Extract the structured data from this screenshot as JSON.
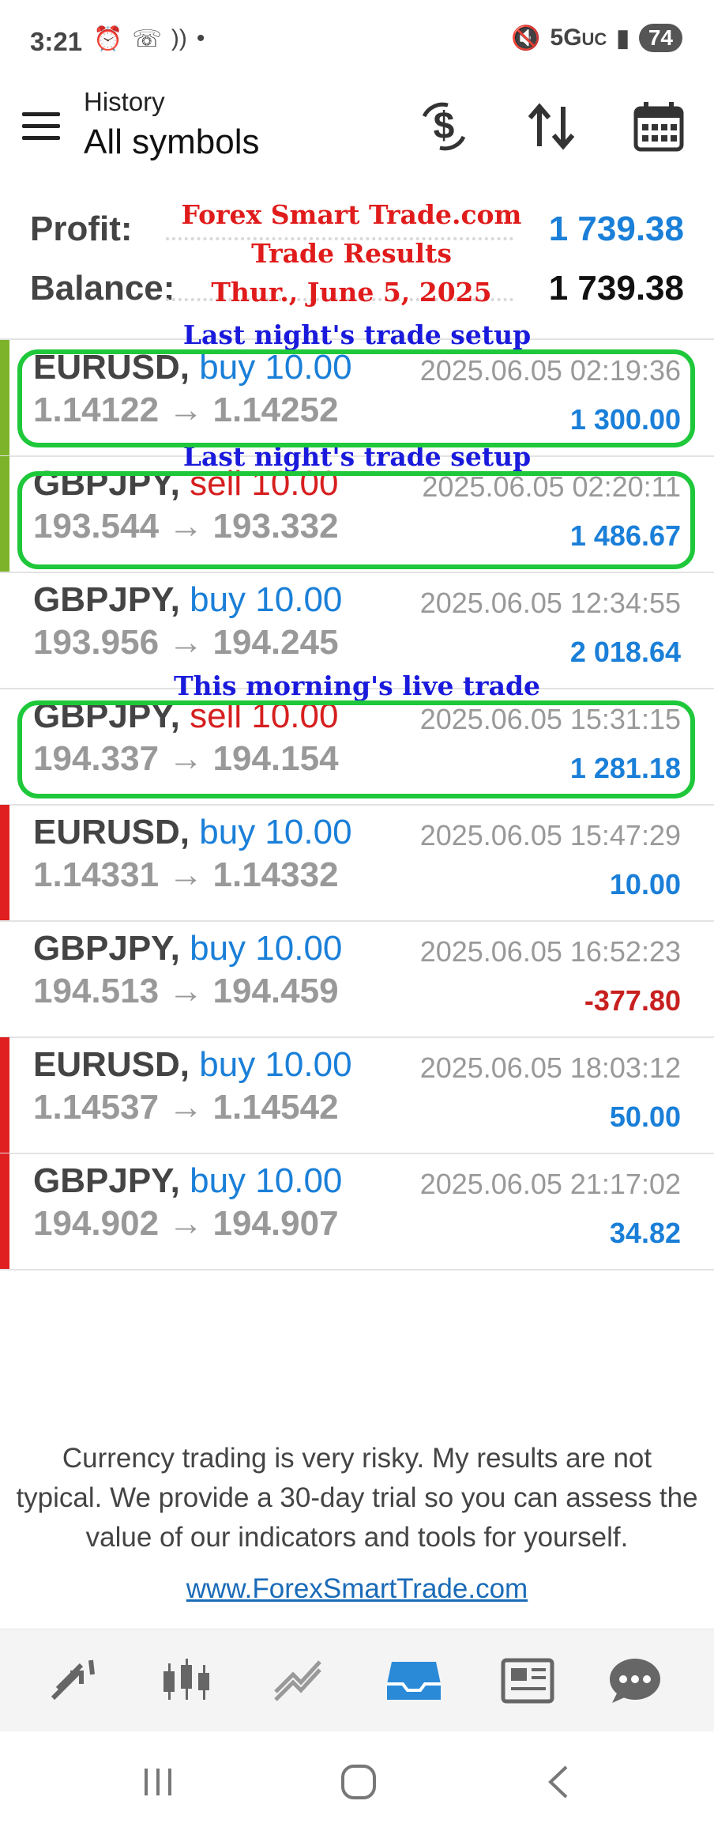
{
  "status": {
    "time": "3:21",
    "network": "5G",
    "network_sub": "UC",
    "battery": "74"
  },
  "header": {
    "subtitle": "History",
    "title": "All symbols"
  },
  "summary": {
    "profit_label": "Profit:",
    "profit_value": "1 739.38",
    "balance_label": "Balance:",
    "balance_value": "1 739.38"
  },
  "overlay": {
    "line1": "Forex Smart Trade.com",
    "line2": "Trade Results",
    "line3": "Thur., June 5, 2025"
  },
  "annotations": {
    "a1": "Last night's trade setup",
    "a2": "Last night's trade setup",
    "a3": "This morning's live trade"
  },
  "trades": [
    {
      "symbol": "EURUSD,",
      "side": "buy 10.00",
      "type": "buy",
      "prices": "1.14122 → 1.14252",
      "date": "2025.06.05 02:19:36",
      "pnl": "1 300.00",
      "bar": "#7db32a"
    },
    {
      "symbol": "GBPJPY,",
      "side": "sell 10.00",
      "type": "sell",
      "prices": "193.544 → 193.332",
      "date": "2025.06.05 02:20:11",
      "pnl": "1 486.67",
      "bar": "#7db32a"
    },
    {
      "symbol": "GBPJPY,",
      "side": "buy 10.00",
      "type": "buy",
      "prices": "193.956 → 194.245",
      "date": "2025.06.05 12:34:55",
      "pnl": "2 018.64",
      "bar": ""
    },
    {
      "symbol": "GBPJPY,",
      "side": "sell 10.00",
      "type": "sell",
      "prices": "194.337 → 194.154",
      "date": "2025.06.05 15:31:15",
      "pnl": "1 281.18",
      "bar": ""
    },
    {
      "symbol": "EURUSD,",
      "side": "buy 10.00",
      "type": "buy",
      "prices": "1.14331 → 1.14332",
      "date": "2025.06.05 15:47:29",
      "pnl": "10.00",
      "bar": "#e02020"
    },
    {
      "symbol": "GBPJPY,",
      "side": "buy 10.00",
      "type": "buy",
      "prices": "194.513 → 194.459",
      "date": "2025.06.05 16:52:23",
      "pnl": "-377.80",
      "bar": ""
    },
    {
      "symbol": "EURUSD,",
      "side": "buy 10.00",
      "type": "buy",
      "prices": "1.14537 → 1.14542",
      "date": "2025.06.05 18:03:12",
      "pnl": "50.00",
      "bar": "#e02020"
    },
    {
      "symbol": "GBPJPY,",
      "side": "buy 10.00",
      "type": "buy",
      "prices": "194.902 → 194.907",
      "date": "2025.06.05 21:17:02",
      "pnl": "34.82",
      "bar": "#e02020"
    }
  ],
  "disclaimer": "Currency trading is very risky. My results are not typical. We provide a 30-day trial so you can assess the value of our indicators and tools for yourself.",
  "link": "www.ForexSmartTrade.com",
  "tabs": [
    "quotes-icon",
    "chart-icon",
    "trade-icon",
    "history-icon",
    "news-icon",
    "chat-icon"
  ],
  "colors": {
    "accent": "#1a7fd8",
    "sell": "#d61f1f",
    "highlight": "#1ec83a",
    "annotation": "#1a1adc",
    "overlay": "#e01b1b"
  }
}
